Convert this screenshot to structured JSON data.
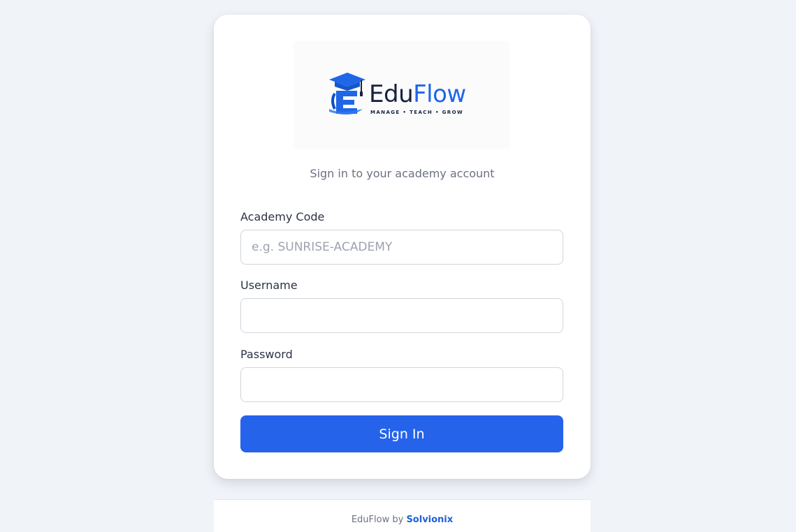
{
  "logo": {
    "word_part1": "Edu",
    "word_part2": "Flow",
    "tagline": "MANAGE • TEACH • GROW"
  },
  "subtitle": "Sign in to your academy account",
  "form": {
    "academy_code": {
      "label": "Academy Code",
      "value": "",
      "placeholder": "e.g. SUNRISE-ACADEMY"
    },
    "username": {
      "label": "Username",
      "value": "",
      "placeholder": ""
    },
    "password": {
      "label": "Password",
      "value": "",
      "placeholder": ""
    },
    "submit_label": "Sign In"
  },
  "footer": {
    "prefix": "EduFlow by ",
    "link_text": "Solvionix"
  },
  "colors": {
    "background": "#f0f3f8",
    "primary": "#2563eb",
    "brand_dark": "#16233f",
    "brand_blue": "#1f67e6"
  },
  "icons": {
    "logo_mark": "graduation-cap-e-icon"
  }
}
